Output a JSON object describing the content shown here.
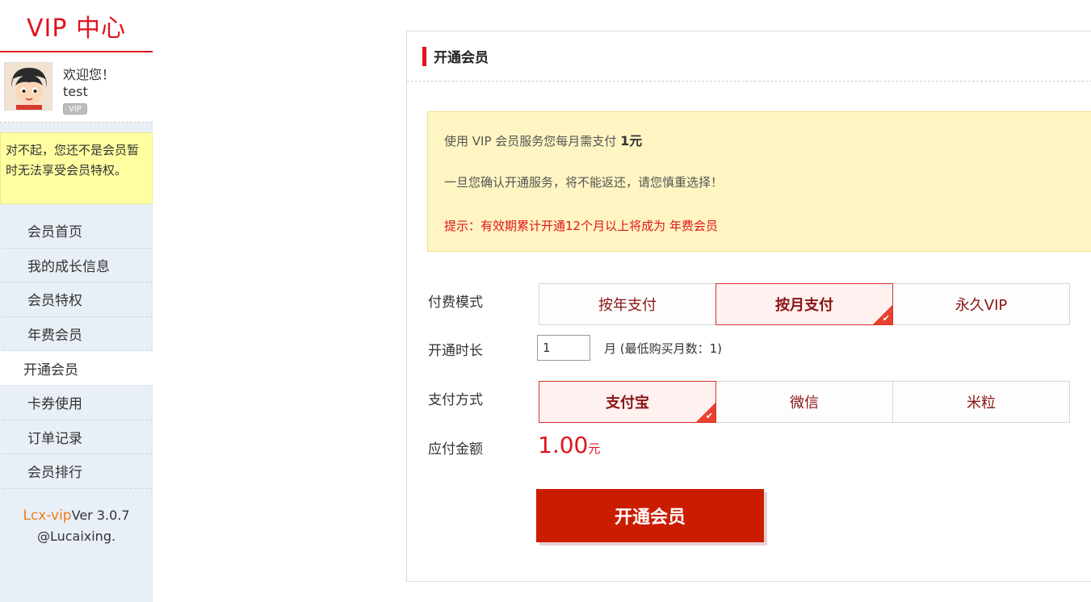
{
  "sidebar": {
    "brand": "VIP 中心",
    "greeting": "欢迎您！",
    "username": "test",
    "badge": "VIP",
    "notice": "对不起，您还不是会员暂时无法享受会员特权。",
    "items": [
      {
        "label": "会员首页"
      },
      {
        "label": "我的成长信息"
      },
      {
        "label": "会员特权"
      },
      {
        "label": "年费会员"
      },
      {
        "label": "开通会员"
      },
      {
        "label": "卡券使用"
      },
      {
        "label": "订单记录"
      },
      {
        "label": "会员排行"
      }
    ],
    "active_index": 4,
    "footer_brand": "Lcx-vip",
    "footer_version": "Ver 3.0.7",
    "footer_author": "@Lucaixing."
  },
  "panel": {
    "title": "开通会员",
    "info": {
      "line1_prefix": "使用 VIP 会员服务您每月需支付",
      "line1_amount": "1元",
      "line2": "一旦您确认开通服务，将不能返还，请您慎重选择！",
      "line3": "提示：有效期累计开通12个月以上将成为 年费会员"
    },
    "pay_mode": {
      "label": "付费模式",
      "options": [
        "按年支付",
        "按月支付",
        "永久VIP"
      ],
      "selected": "按月支付"
    },
    "duration": {
      "label": "开通时长",
      "value": "1",
      "note": "月 (最低购买月数：1)"
    },
    "pay_method": {
      "label": "支付方式",
      "options": [
        "支付宝",
        "微信",
        "米粒"
      ],
      "selected": "支付宝"
    },
    "amount": {
      "label": "应付金额",
      "value": "1.00",
      "unit": "元"
    },
    "submit_label": "开通会员"
  },
  "colors": {
    "accent": "#e0141e",
    "submit": "#cc1c00",
    "notice_bg": "#ffffa1",
    "info_bg": "#fff5c2"
  }
}
